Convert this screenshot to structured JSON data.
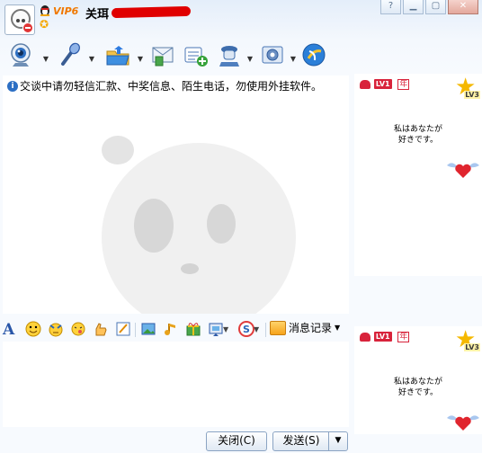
{
  "window": {
    "vip_badge": "VIP6",
    "contact_name": "关珥",
    "controls": [
      "help",
      "minimize",
      "maximize",
      "close"
    ]
  },
  "toolbar": {
    "buttons": [
      {
        "name": "video-call",
        "icon": "webcam-icon",
        "has_menu": true
      },
      {
        "name": "voice-call",
        "icon": "microphone-icon",
        "has_menu": true
      },
      {
        "name": "send-file",
        "icon": "folder-icon",
        "has_menu": true
      },
      {
        "name": "send-sms",
        "icon": "sms-icon",
        "has_menu": false
      },
      {
        "name": "create-discussion",
        "icon": "add-discussion-icon",
        "has_menu": false
      },
      {
        "name": "remote-assist",
        "icon": "remote-icon",
        "has_menu": true
      },
      {
        "name": "apps",
        "icon": "apps-icon",
        "has_menu": true
      },
      {
        "name": "qzone",
        "icon": "qzone-icon",
        "has_menu": false
      }
    ]
  },
  "notice": {
    "text": "交谈中请勿轻信汇款、中奖信息、陌生电话，勿使用外挂软件。"
  },
  "format_bar": {
    "history_label": "消息记录"
  },
  "buttons": {
    "close_label": "关闭(C)",
    "send_label": "发送(S)"
  },
  "show_panels": [
    {
      "level_badge": "LV1",
      "year_badge": "年",
      "star_level": "LV3",
      "caption_line1": "私はあなたが",
      "caption_line2": "好きです。"
    },
    {
      "level_badge": "LV1",
      "year_badge": "年",
      "star_level": "LV3",
      "caption_line1": "私はあなたが",
      "caption_line2": "好きです。"
    }
  ],
  "colors": {
    "accent": "#2c6fc4",
    "redaction": "#e00000",
    "vip": "#f07800"
  }
}
